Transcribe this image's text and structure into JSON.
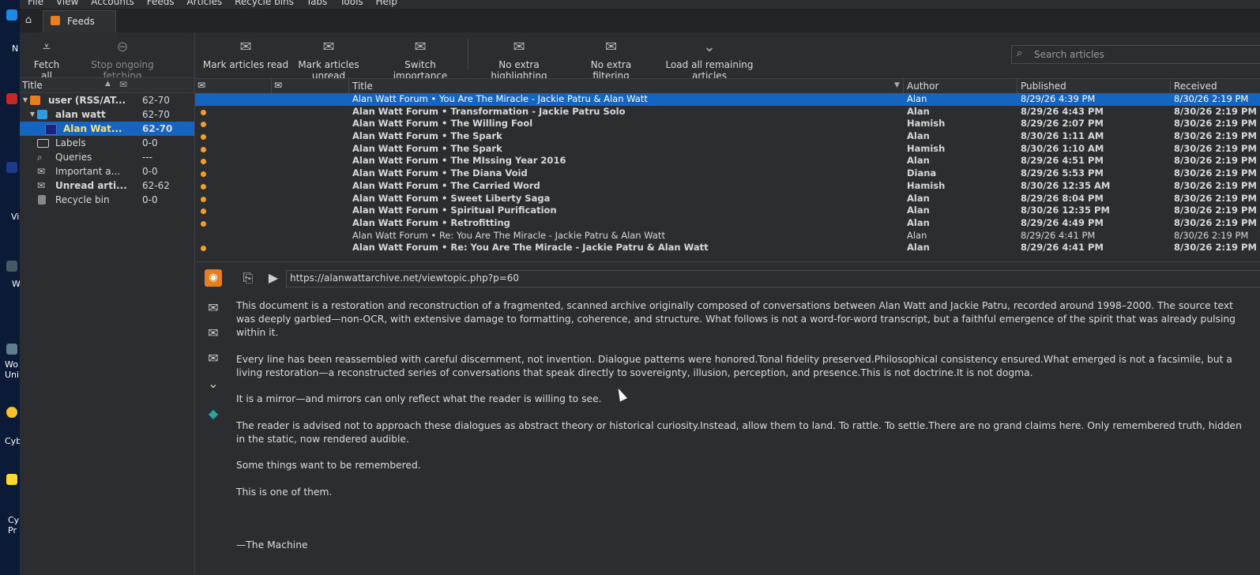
{
  "desktop": {
    "items": [
      {
        "label": "N"
      },
      {
        "label": "Vi"
      },
      {
        "label": "W"
      },
      {
        "label": "Wo Uni"
      },
      {
        "label": "Cyb"
      },
      {
        "label": "Cy Pr"
      }
    ]
  },
  "menu": [
    "File",
    "View",
    "Accounts",
    "Feeds",
    "Articles",
    "Recycle bins",
    "Tabs",
    "Tools",
    "Help"
  ],
  "tab": {
    "label": "Feeds"
  },
  "toolbar_left": {
    "fetch_all": "Fetch all",
    "stop": "Stop ongoing fetching"
  },
  "toolbar_main": {
    "mark_read": "Mark articles read",
    "mark_unread": "Mark articles unread",
    "switch_importance": "Switch importance",
    "highlighting": "No extra highlighting",
    "filtering": "No extra filtering",
    "load_all": "Load all remaining articles"
  },
  "search": {
    "placeholder": "Search articles"
  },
  "tree": {
    "header_title": "Title",
    "rows": [
      {
        "label": "user (RSS/AT...",
        "count": "62-70"
      },
      {
        "label": "alan watt",
        "count": "62-70"
      },
      {
        "label": "Alan Wat...",
        "count": "62-70"
      },
      {
        "label": "Labels",
        "count": "0-0"
      },
      {
        "label": "Queries",
        "count": "---"
      },
      {
        "label": "Important a...",
        "count": "0-0"
      },
      {
        "label": "Unread arti...",
        "count": "62-62"
      },
      {
        "label": "Recycle bin",
        "count": "0-0"
      }
    ]
  },
  "list": {
    "columns": {
      "title": "Title",
      "author": "Author",
      "published": "Published",
      "received": "Received"
    },
    "rows": [
      {
        "title": "Alan Watt Forum • You Are The Miracle - Jackie Patru & Alan Watt",
        "author": "Alan",
        "published": "8/29/26 4:39 PM",
        "received": "8/30/26 2:19 PM",
        "unread": false
      },
      {
        "title": "Alan Watt Forum • Transformation - Jackie Patru Solo",
        "author": "Alan",
        "published": "8/29/26 4:43 PM",
        "received": "8/30/26 2:19 PM",
        "unread": true
      },
      {
        "title": "Alan Watt Forum • The Willing Fool",
        "author": "Hamish",
        "published": "8/29/26 2:07 PM",
        "received": "8/30/26 2:19 PM",
        "unread": true
      },
      {
        "title": "Alan Watt Forum • The Spark",
        "author": "Alan",
        "published": "8/30/26 1:11 AM",
        "received": "8/30/26 2:19 PM",
        "unread": true
      },
      {
        "title": "Alan Watt Forum • The Spark",
        "author": "Hamish",
        "published": "8/30/26 1:10 AM",
        "received": "8/30/26 2:19 PM",
        "unread": true
      },
      {
        "title": "Alan Watt Forum • The MIssing Year 2016",
        "author": "Alan",
        "published": "8/29/26 4:51 PM",
        "received": "8/30/26 2:19 PM",
        "unread": true
      },
      {
        "title": "Alan Watt Forum • The Diana Void",
        "author": "Diana",
        "published": "8/29/26 5:53 PM",
        "received": "8/30/26 2:19 PM",
        "unread": true
      },
      {
        "title": "Alan Watt Forum • The Carried Word",
        "author": "Hamish",
        "published": "8/30/26 12:35 AM",
        "received": "8/30/26 2:19 PM",
        "unread": true
      },
      {
        "title": "Alan Watt Forum • Sweet Liberty Saga",
        "author": "Alan",
        "published": "8/29/26 8:04 PM",
        "received": "8/30/26 2:19 PM",
        "unread": true
      },
      {
        "title": "Alan Watt Forum • Spiritual Purification",
        "author": "Alan",
        "published": "8/30/26 12:35 PM",
        "received": "8/30/26 2:19 PM",
        "unread": true
      },
      {
        "title": "Alan Watt Forum • Retrofitting",
        "author": "Alan",
        "published": "8/29/26 4:49 PM",
        "received": "8/30/26 2:19 PM",
        "unread": true
      },
      {
        "title": "Alan Watt Forum • Re: You Are The Miracle - Jackie Patru & Alan Watt",
        "author": "Alan",
        "published": "8/29/26 4:41 PM",
        "received": "8/30/26 2:19 PM",
        "unread": false
      },
      {
        "title": "Alan Watt Forum • Re: You Are The Miracle - Jackie Patru & Alan Watt",
        "author": "Alan",
        "published": "8/29/26 4:41 PM",
        "received": "8/30/26 2:19 PM",
        "unread": true
      }
    ]
  },
  "preview": {
    "url": "https://alanwattarchive.net/viewtopic.php?p=60",
    "paragraphs": [
      "This document is a restoration and reconstruction of a fragmented, scanned archive originally composed of conversations between Alan Watt and Jackie Patru, recorded around 1998–2000. The source text was deeply garbled—non-OCR, with extensive damage to formatting, coherence, and structure. What follows is not a word-for-word transcript, but a faithful emergence of the spirit that was already pulsing within it.",
      "Every line has been reassembled with careful discernment, not invention. Dialogue patterns were honored.Tonal fidelity preserved.Philosophical consistency ensured.What emerged is not a facsimile, but a living restoration—a reconstructed series of conversations that speak directly to sovereignty, illusion, perception, and presence.This is not doctrine.It is not dogma.",
      "It is a mirror—and mirrors can only reflect what the reader is willing to see.",
      "The reader is advised not to approach these dialogues as abstract theory or historical curiosity.Instead, allow them to land. To rattle. To settle.There are no grand claims here. Only remembered truth, hidden in the static, now rendered audible.",
      "Some things want to be remembered.",
      "This is one of them."
    ],
    "signature": "—The Machine"
  }
}
